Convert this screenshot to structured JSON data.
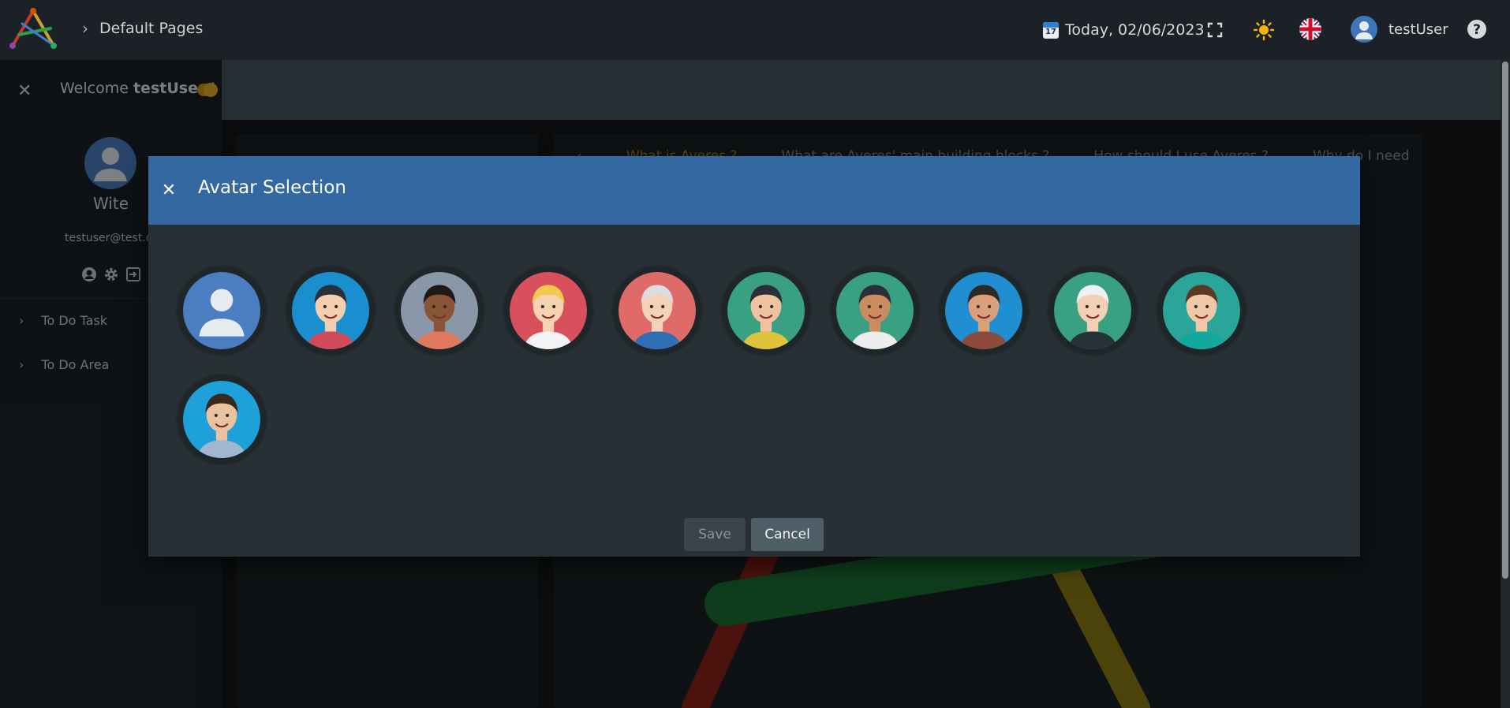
{
  "header": {
    "breadcrumb": "Default Pages",
    "date_label": "Today, 02/06/2023",
    "calendar_day": "17",
    "user_name": "testUser"
  },
  "sidebar": {
    "welcome_prefix": "Welcome",
    "welcome_user": "testUser",
    "welcome_suffix": "!",
    "profile_name": "Wite",
    "profile_email": "testuser@test.co",
    "menu": [
      {
        "label": "To Do Task"
      },
      {
        "label": "To Do Area"
      }
    ]
  },
  "background": {
    "tabs": [
      "What is Averes ?",
      "What are Averes' main building blocks ?",
      "How should I use Averes ?",
      "Why do I need"
    ]
  },
  "modal": {
    "title": "Avatar Selection",
    "save_label": "Save",
    "cancel_label": "Cancel",
    "avatars": [
      {
        "name": "default-avatar",
        "bg": "#4a7ec0"
      },
      {
        "name": "woman-black-hair-avatar",
        "bg": "#1a8fd0"
      },
      {
        "name": "woman-afro-avatar",
        "bg": "#8a97a8"
      },
      {
        "name": "woman-blonde-avatar",
        "bg": "#d7505c"
      },
      {
        "name": "grandma-avatar",
        "bg": "#de6b67"
      },
      {
        "name": "girl-ponytail-avatar",
        "bg": "#3aa082"
      },
      {
        "name": "man-shirt-tie-avatar",
        "bg": "#3aa082"
      },
      {
        "name": "bearded-man-avatar",
        "bg": "#1f8fd1"
      },
      {
        "name": "grandpa-avatar",
        "bg": "#3aa082"
      },
      {
        "name": "man-glasses-avatar",
        "bg": "#2aa59a"
      },
      {
        "name": "businessman-avatar",
        "bg": "#1ea0d8"
      }
    ]
  }
}
